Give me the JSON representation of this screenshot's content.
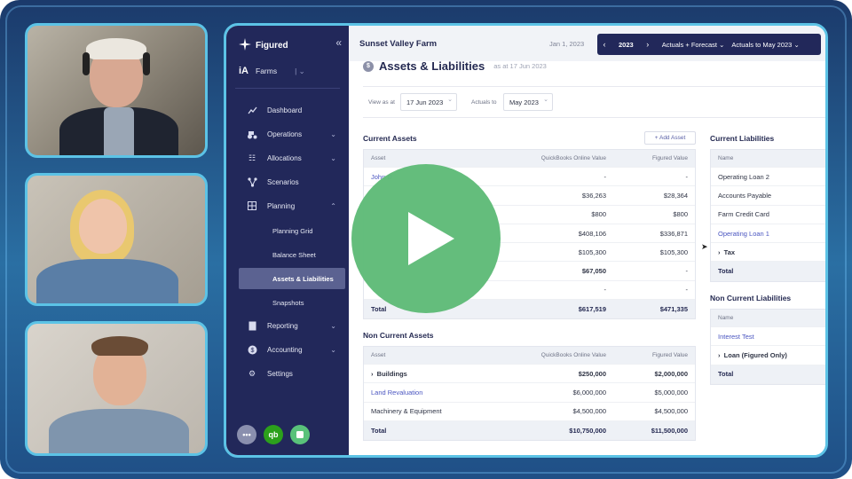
{
  "colors": {
    "sidebar": "#22285a",
    "accent_border": "#5cc3e6",
    "link": "#4a55c0",
    "play": "#5fbb78"
  },
  "app": {
    "brand": "Figured",
    "collapse_icon": "double-chevron-left-icon"
  },
  "sidebar": {
    "farm_switch_label": "Farms",
    "items": [
      {
        "label": "Dashboard",
        "icon": "chart-line-icon"
      },
      {
        "label": "Operations",
        "icon": "tractor-icon",
        "has_chevron": true
      },
      {
        "label": "Allocations",
        "icon": "list-icon",
        "has_chevron": true
      },
      {
        "label": "Scenarios",
        "icon": "branch-icon"
      },
      {
        "label": "Planning",
        "icon": "grid-icon",
        "has_chevron": true,
        "expanded": true
      },
      {
        "label": "Reporting",
        "icon": "document-icon",
        "has_chevron": true
      },
      {
        "label": "Accounting",
        "icon": "dollar-icon",
        "has_chevron": true
      },
      {
        "label": "Settings",
        "icon": "gear-icon"
      }
    ],
    "planning_sub": [
      {
        "label": "Planning Grid",
        "active": false
      },
      {
        "label": "Balance Sheet",
        "active": false
      },
      {
        "label": "Assets & Liabilities",
        "active": true
      },
      {
        "label": "Snapshots",
        "active": false
      }
    ],
    "bottom": [
      "more-icon",
      "quickbooks-icon",
      "chat-icon"
    ]
  },
  "topbar": {
    "farm_name": "Sunset Valley Farm",
    "date": "Jan 1, 2023",
    "year": "2023",
    "mode": "Actuals + Forecast",
    "actuals_to": "Actuals to May 2023"
  },
  "page": {
    "title": "Assets & Liabilities",
    "as_at": "as at 17 Jun 2023",
    "view_as_at_label": "View as at",
    "view_as_at_value": "17 Jun 2023",
    "actuals_to_label": "Actuals to",
    "actuals_to_value": "May 2023"
  },
  "current_assets": {
    "title": "Current Assets",
    "add_button": "+ Add Asset",
    "headers": [
      "Asset",
      "QuickBooks Online Value",
      "Figured Value"
    ],
    "rows": [
      {
        "name": "John D",
        "qbo": "-",
        "figured": "-",
        "link": true
      },
      {
        "name": "",
        "qbo": "$36,263",
        "figured": "$28,364"
      },
      {
        "name": "",
        "qbo": "$800",
        "figured": "$800"
      },
      {
        "name": "",
        "qbo": "$408,106",
        "figured": "$336,871"
      },
      {
        "name": "",
        "qbo": "$105,300",
        "figured": "$105,300"
      },
      {
        "name": "",
        "qbo": "$67,050",
        "figured": "-",
        "bold": true
      },
      {
        "name": "",
        "qbo": "-",
        "figured": "-"
      }
    ],
    "total": {
      "name": "Total",
      "qbo": "$617,519",
      "figured": "$471,335"
    }
  },
  "non_current_assets": {
    "title": "Non Current Assets",
    "headers": [
      "Asset",
      "QuickBooks Online Value",
      "Figured Value"
    ],
    "rows": [
      {
        "name": "Buildings",
        "qbo": "$250,000",
        "figured": "$2,000,000",
        "bold": true,
        "expandable": true
      },
      {
        "name": "Land Revaluation",
        "qbo": "$6,000,000",
        "figured": "$5,000,000",
        "link": true
      },
      {
        "name": "Machinery & Equipment",
        "qbo": "$4,500,000",
        "figured": "$4,500,000"
      }
    ],
    "total": {
      "name": "Total",
      "qbo": "$10,750,000",
      "figured": "$11,500,000"
    }
  },
  "current_liabilities": {
    "title": "Current Liabilities",
    "header": "Name",
    "rows": [
      {
        "name": "Operating Loan 2"
      },
      {
        "name": "Accounts Payable"
      },
      {
        "name": "Farm Credit Card"
      },
      {
        "name": "Operating Loan 1",
        "link": true
      },
      {
        "name": "Tax",
        "bold": true,
        "expandable": true
      }
    ],
    "total": "Total"
  },
  "non_current_liabilities": {
    "title": "Non Current Liabilities",
    "header": "Name",
    "rows": [
      {
        "name": "Interest Test",
        "link": true
      },
      {
        "name": "Loan (Figured Only)",
        "bold": true,
        "expandable": true
      }
    ],
    "total": "Total"
  },
  "overlay": {
    "play_icon": "play-icon"
  }
}
